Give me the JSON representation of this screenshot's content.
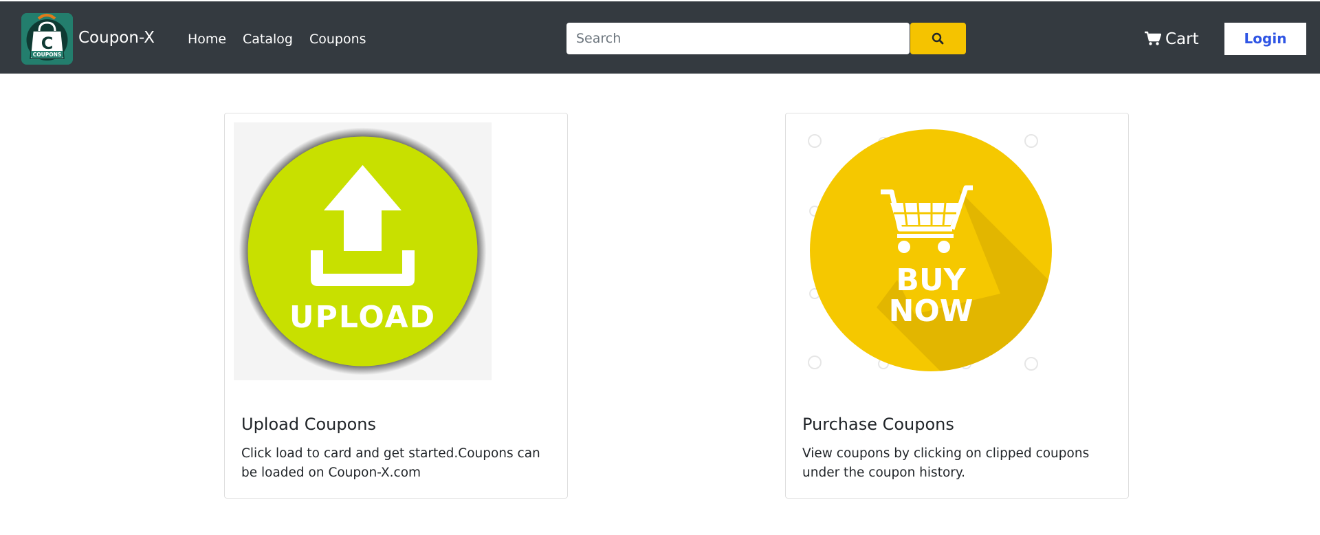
{
  "brand": {
    "name": "Coupon-X",
    "logo_text": "COUPONS",
    "logo_letter": "C"
  },
  "nav": {
    "links": [
      {
        "label": "Home"
      },
      {
        "label": "Catalog"
      },
      {
        "label": "Coupons"
      }
    ]
  },
  "search": {
    "placeholder": "Search",
    "value": ""
  },
  "header_actions": {
    "cart_label": "Cart",
    "login_label": "Login"
  },
  "cards": [
    {
      "title": "Upload Coupons",
      "text": "Click load to card and get started.Coupons can be loaded on Coupon-X.com",
      "image_caption": "UPLOAD"
    },
    {
      "title": "Purchase Coupons",
      "text": "View coupons by clicking on clipped coupons under the coupon history.",
      "image_caption_line1": "BUY",
      "image_caption_line2": "NOW"
    }
  ],
  "colors": {
    "navbar": "#343a40",
    "search_button": "#f5c300",
    "login_text": "#2f55e4",
    "upload_green": "#c8e000",
    "buy_yellow": "#f5c800"
  }
}
